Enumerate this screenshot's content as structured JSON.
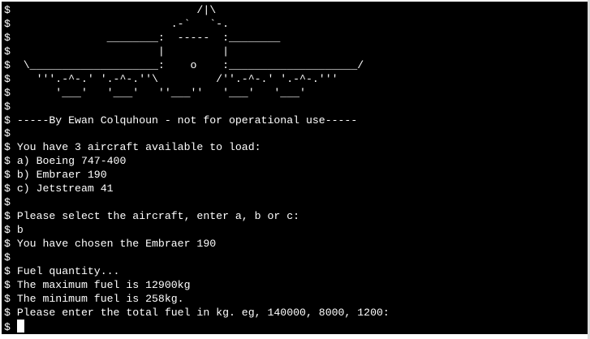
{
  "terminal": {
    "lines": [
      "$                             /|\\",
      "$                         .-`   `-.",
      "$               ________:  -----  :________",
      "$                       |         |",
      "$  \\____________________:    o    :____________________/",
      "$    '''.-^-.' '.-^-.''\\         /''.-^-.' '.-^-.'''",
      "$       '___'   '___'   ''___''   '___'   '___'",
      "$",
      "$ -----By Ewan Colquhoun - not for operational use-----",
      "$",
      "$ You have 3 aircraft available to load:",
      "$ a) Boeing 747-400",
      "$ b) Embraer 190",
      "$ c) Jetstream 41",
      "$",
      "$ Please select the aircraft, enter a, b or c:",
      "$ b",
      "$ You have chosen the Embraer 190",
      "$",
      "$ Fuel quantity...",
      "$ The maximum fuel is 12900kg",
      "$ The minimum fuel is 258kg.",
      "$ Please enter the total fuel in kg. eg, 140000, 8000, 1200:"
    ],
    "prompt": "$ "
  },
  "colors": {
    "background": "#000000",
    "foreground": "#ffffff"
  }
}
